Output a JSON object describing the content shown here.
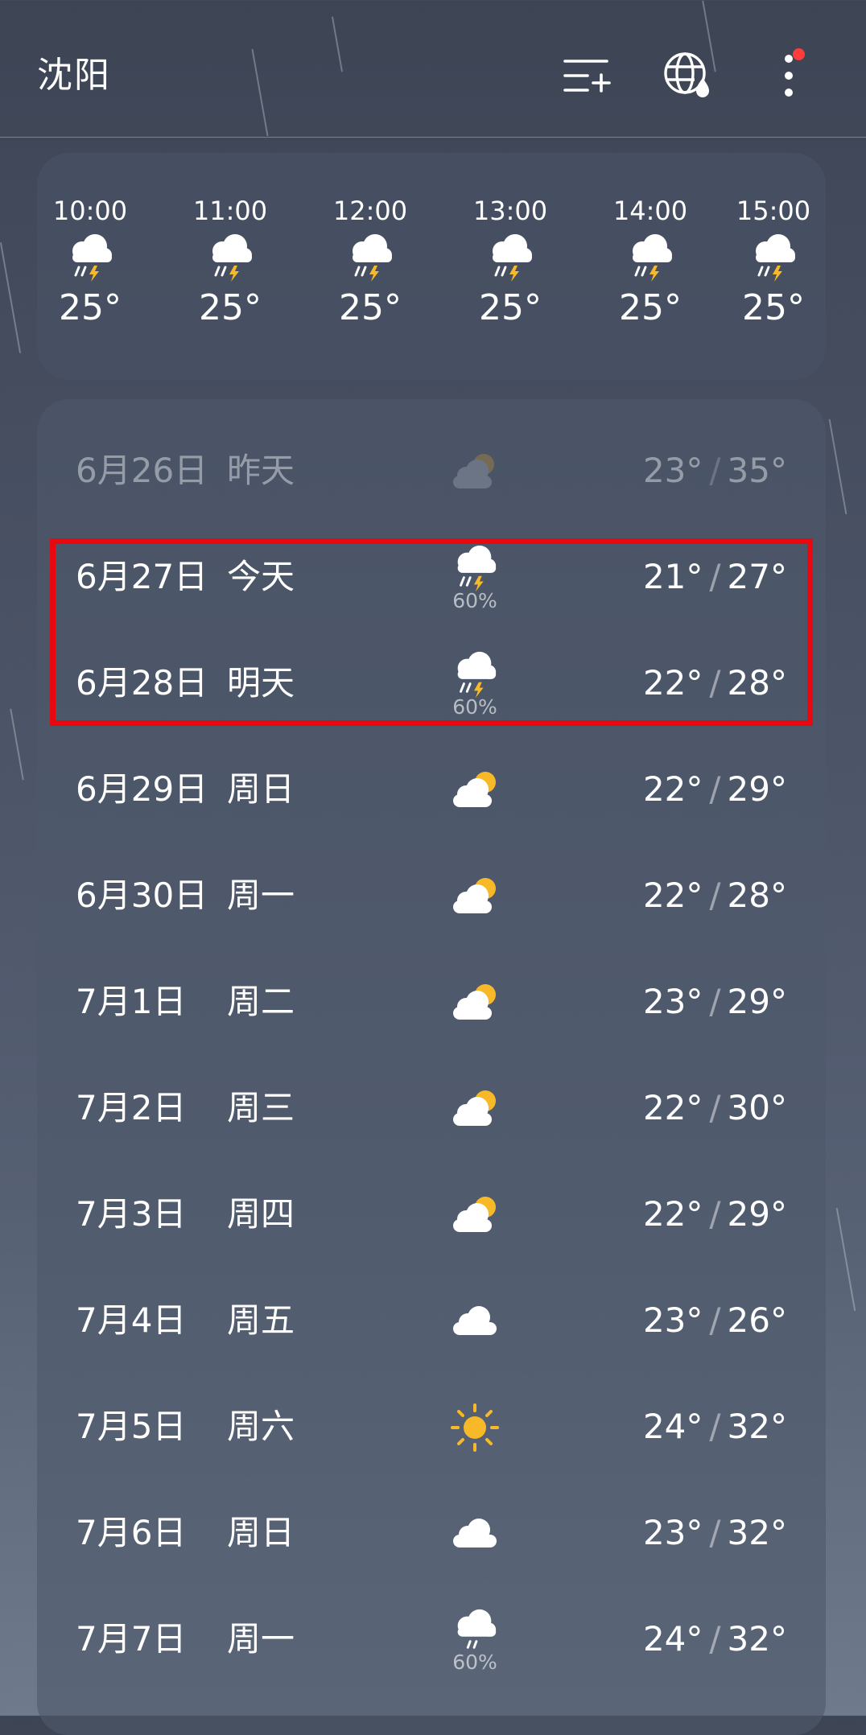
{
  "header": {
    "city": "沈阳"
  },
  "icons": {
    "manage_cities": "list-add-icon",
    "globe": "globe-icon",
    "more": "more-vertical-icon"
  },
  "colors": {
    "highlight": "#e8080f",
    "sun": "#f7b928",
    "bolt": "#f7b928",
    "badge": "#ff3b3b"
  },
  "hourly": [
    {
      "time": "10:00",
      "icon": "thunderstorm-icon",
      "temp": "25°"
    },
    {
      "time": "11:00",
      "icon": "thunderstorm-icon",
      "temp": "25°"
    },
    {
      "time": "12:00",
      "icon": "thunderstorm-icon",
      "temp": "25°"
    },
    {
      "time": "13:00",
      "icon": "thunderstorm-icon",
      "temp": "25°"
    },
    {
      "time": "14:00",
      "icon": "thunderstorm-icon",
      "temp": "25°"
    },
    {
      "time": "15:00",
      "icon": "thunderstorm-icon",
      "temp": "25°"
    }
  ],
  "daily": [
    {
      "date": "6月26日",
      "day": "昨天",
      "icon": "partly-cloudy-icon",
      "prob": "",
      "low": "23°",
      "high": "35°",
      "faded": true
    },
    {
      "date": "6月27日",
      "day": "今天",
      "icon": "thunderstorm-icon",
      "prob": "60%",
      "low": "21°",
      "high": "27°"
    },
    {
      "date": "6月28日",
      "day": "明天",
      "icon": "thunderstorm-icon",
      "prob": "60%",
      "low": "22°",
      "high": "28°"
    },
    {
      "date": "6月29日",
      "day": "周日",
      "icon": "partly-cloudy-icon",
      "prob": "",
      "low": "22°",
      "high": "29°"
    },
    {
      "date": "6月30日",
      "day": "周一",
      "icon": "partly-cloudy-icon",
      "prob": "",
      "low": "22°",
      "high": "28°"
    },
    {
      "date": "7月1日",
      "day": "周二",
      "icon": "partly-cloudy-icon",
      "prob": "",
      "low": "23°",
      "high": "29°"
    },
    {
      "date": "7月2日",
      "day": "周三",
      "icon": "partly-cloudy-icon",
      "prob": "",
      "low": "22°",
      "high": "30°"
    },
    {
      "date": "7月3日",
      "day": "周四",
      "icon": "partly-cloudy-icon",
      "prob": "",
      "low": "22°",
      "high": "29°"
    },
    {
      "date": "7月4日",
      "day": "周五",
      "icon": "cloudy-icon",
      "prob": "",
      "low": "23°",
      "high": "26°"
    },
    {
      "date": "7月5日",
      "day": "周六",
      "icon": "sunny-icon",
      "prob": "",
      "low": "24°",
      "high": "32°"
    },
    {
      "date": "7月6日",
      "day": "周日",
      "icon": "cloudy-icon",
      "prob": "",
      "low": "23°",
      "high": "32°"
    },
    {
      "date": "7月7日",
      "day": "周一",
      "icon": "rain-icon",
      "prob": "60%",
      "low": "24°",
      "high": "32°"
    }
  ],
  "separator": "/"
}
